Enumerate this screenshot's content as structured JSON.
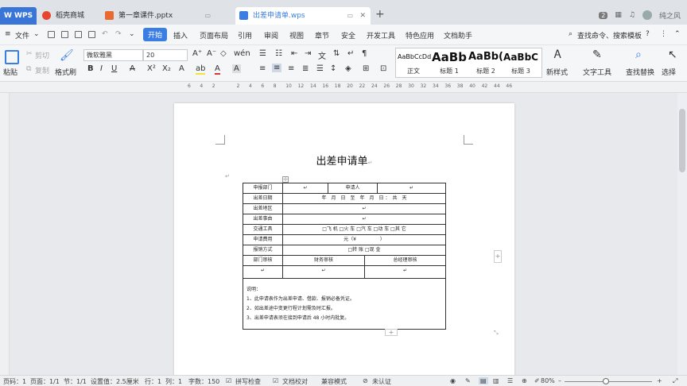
{
  "tabbar": {
    "app_name": "W WPS",
    "tabs": [
      {
        "label": "稻壳商城",
        "active": false
      },
      {
        "label": "第一章课件.pptx",
        "active": false
      },
      {
        "label": "出差申请单.wps",
        "active": true
      }
    ],
    "badge": "2",
    "user": "纯之风"
  },
  "menubar": {
    "file": "文件",
    "items": [
      "开始",
      "插入",
      "页面布局",
      "引用",
      "审阅",
      "视图",
      "章节",
      "安全",
      "开发工具",
      "特色应用",
      "文档助手"
    ],
    "search": "查找命令、搜索模板",
    "help": "?"
  },
  "ribbon": {
    "paste": "粘贴",
    "cut": "剪切",
    "copy": "复制",
    "format_painter": "格式刷",
    "font_name": "微软雅黑",
    "font_size": "20",
    "styles": [
      {
        "preview": "AaBbCcDd",
        "label": "正文"
      },
      {
        "preview": "AaBb",
        "label": "标题 1"
      },
      {
        "preview": "AaBb(",
        "label": "标题 2"
      },
      {
        "preview": "AaBbC",
        "label": "标题 3"
      }
    ],
    "new_style": "新样式",
    "text_tools": "文字工具",
    "find_replace": "查找替换",
    "select": "选择"
  },
  "ruler": {
    "ticks": [
      "6",
      "4",
      "2",
      "",
      "2",
      "4",
      "6",
      "8",
      "10",
      "12",
      "14",
      "16",
      "18",
      "20",
      "22",
      "24",
      "26",
      "28",
      "30",
      "32",
      "34",
      "36",
      "38",
      "40",
      "42",
      "44",
      "46"
    ]
  },
  "document": {
    "title": "出差申请单",
    "rows": [
      [
        "申报部门",
        "↵",
        "申请人",
        "↵"
      ],
      [
        "出差日期",
        "年　月　日　至　年　月　日 ：　共　天"
      ],
      [
        "出差地区",
        "↵"
      ],
      [
        "出差事由",
        "↵"
      ],
      [
        "交通工具",
        "□飞 机 □火 车 □汽 车 □动 车 □其 它"
      ],
      [
        "申请费用",
        "元（¥　　　　　）"
      ],
      [
        "报销方式",
        "□转 账 □现 金"
      ],
      [
        "部门审核",
        "财务审核",
        "总经理审核"
      ],
      [
        "↵",
        "↵",
        "↵"
      ]
    ],
    "notes": [
      "说明：",
      "1、此申请表作为出差申请、借款、报销必备凭证。",
      "2、如出差途中变更行程计划需及时汇报。",
      "3、出差申请表须在接到申请后 48 小时内批复。"
    ]
  },
  "statusbar": {
    "page_num": "页码：1",
    "pages": "页面：1/1",
    "section": "节：1/1",
    "setting": "设置值：2.5厘米",
    "row": "行：1",
    "col": "列：1",
    "word_count": "字数：150",
    "spell_check": "拼写检查",
    "doc_proof": "文档校对",
    "compat": "兼容模式",
    "cert": "未认证",
    "zoom": "80%"
  }
}
